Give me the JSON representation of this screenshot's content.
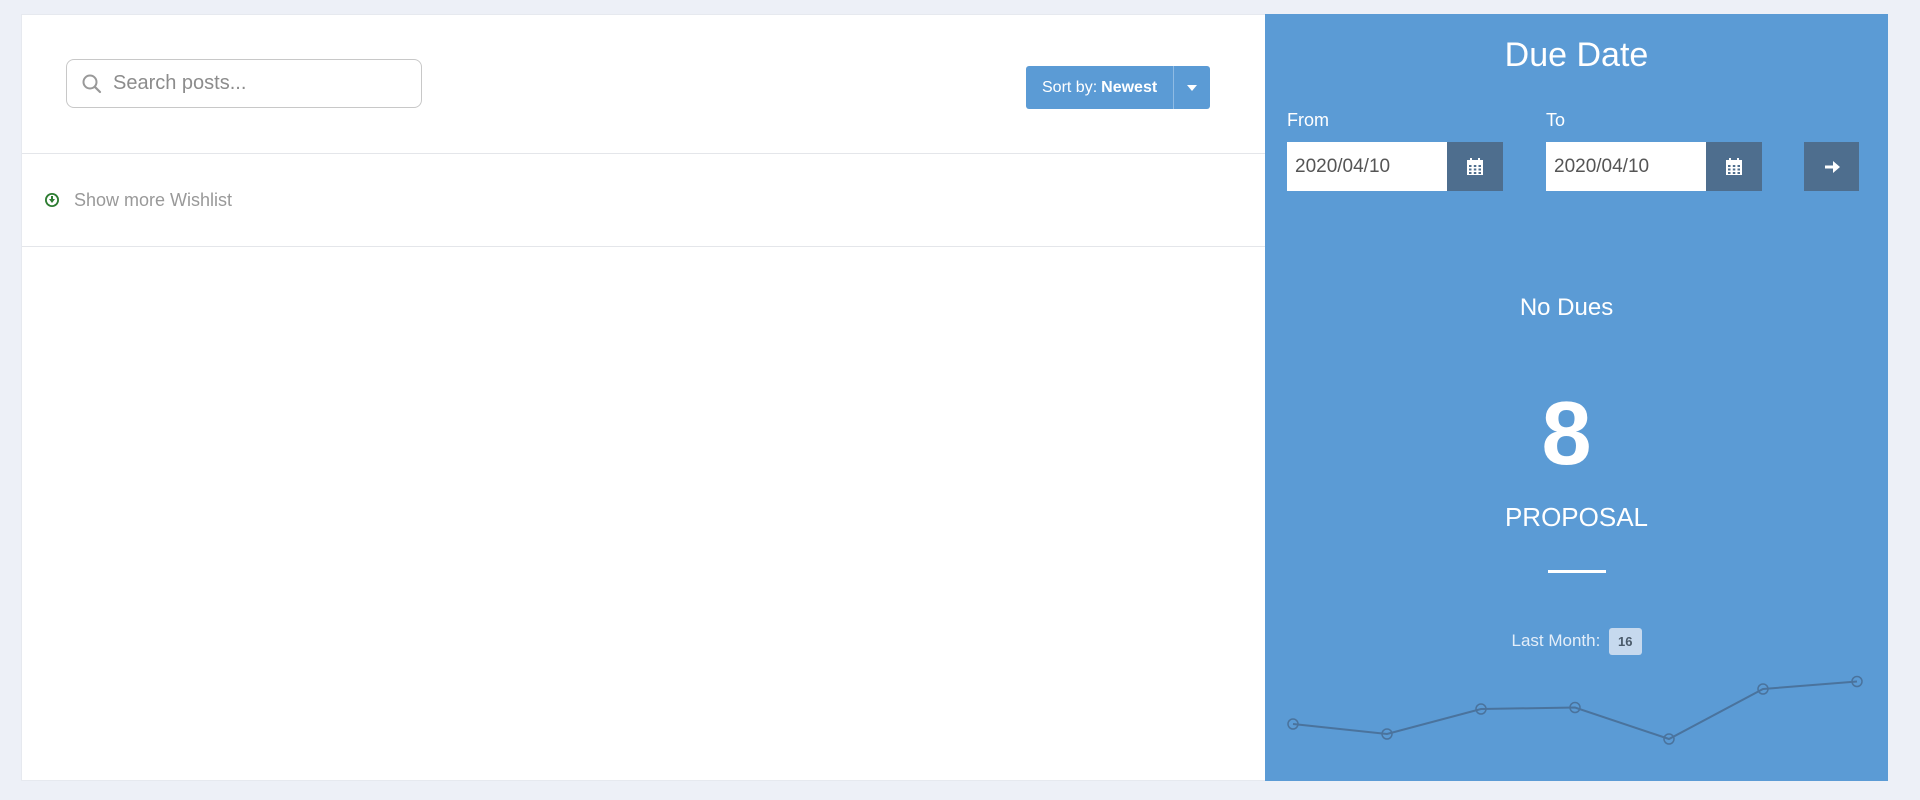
{
  "search": {
    "placeholder": "Search posts..."
  },
  "sort": {
    "prefix": "Sort by:",
    "value": "Newest"
  },
  "wishlist": {
    "show_more_label": "Show more Wishlist"
  },
  "due_date": {
    "title": "Due Date",
    "from_label": "From",
    "from_value": "2020/04/10",
    "to_label": "To",
    "to_value": "2020/04/10"
  },
  "summary": {
    "status": "No Dues",
    "count": "8",
    "count_label": "PROPOSAL",
    "last_month_label": "Last Month:",
    "last_month_value": "16"
  },
  "colors": {
    "accent": "#5b9bd5",
    "button_dark": "#4e6e8e",
    "sparkline": "#4a739d"
  },
  "icons": {
    "search": "search-icon",
    "calendar": "calendar-icon",
    "arrow": "arrow-right-icon",
    "caret": "chevron-down-icon",
    "show_more": "circle-arrow-down-icon"
  },
  "chart_data": {
    "type": "line",
    "x": [
      1,
      2,
      3,
      4,
      5,
      6,
      7
    ],
    "values": [
      8,
      6,
      11,
      11.3,
      5,
      15,
      16.5
    ],
    "title": "",
    "xlabel": "",
    "ylabel": "",
    "ylim": [
      0,
      20
    ],
    "grid": false
  }
}
